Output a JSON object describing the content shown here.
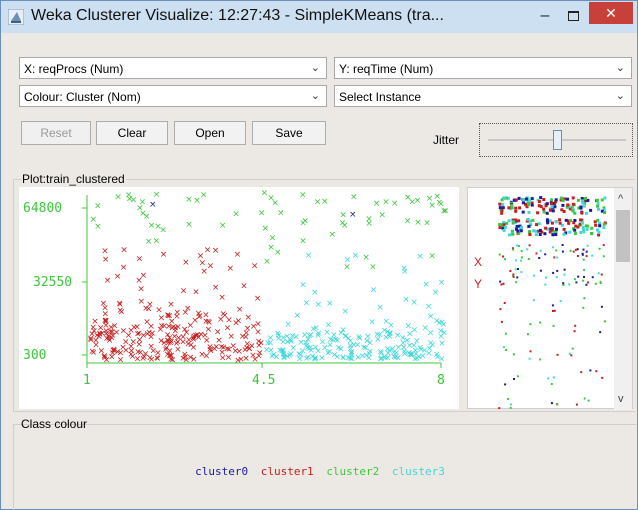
{
  "window": {
    "title": "Weka Clusterer Visualize: 12:27:43 - SimpleKMeans (tra...",
    "min_glyph": "–",
    "close_glyph": "✕"
  },
  "controls": {
    "x_axis": "X: reqProcs (Num)",
    "y_axis": "Y: reqTime (Num)",
    "colour": "Colour: Cluster (Nom)",
    "instance": "Select Instance",
    "reset": "Reset",
    "clear": "Clear",
    "open": "Open",
    "save": "Save",
    "jitter": "Jitter",
    "jitter_level": 0.5,
    "dropdown_glyph": "⌄"
  },
  "plot": {
    "title": "Plot:train_clustered",
    "y_ticks": [
      "64800",
      "32550",
      "300"
    ],
    "x_ticks": [
      "1",
      "4.5",
      "8"
    ],
    "axis_color": "#3cc73c"
  },
  "attr_panel": {
    "x_label": "X",
    "y_label": "Y"
  },
  "class_colour": {
    "title": "Class colour",
    "clusters": [
      {
        "name": "cluster0",
        "color": "#1a1a9e"
      },
      {
        "name": "cluster1",
        "color": "#c81e1e"
      },
      {
        "name": "cluster2",
        "color": "#3cc73c"
      },
      {
        "name": "cluster3",
        "color": "#40d8d8"
      }
    ]
  }
}
